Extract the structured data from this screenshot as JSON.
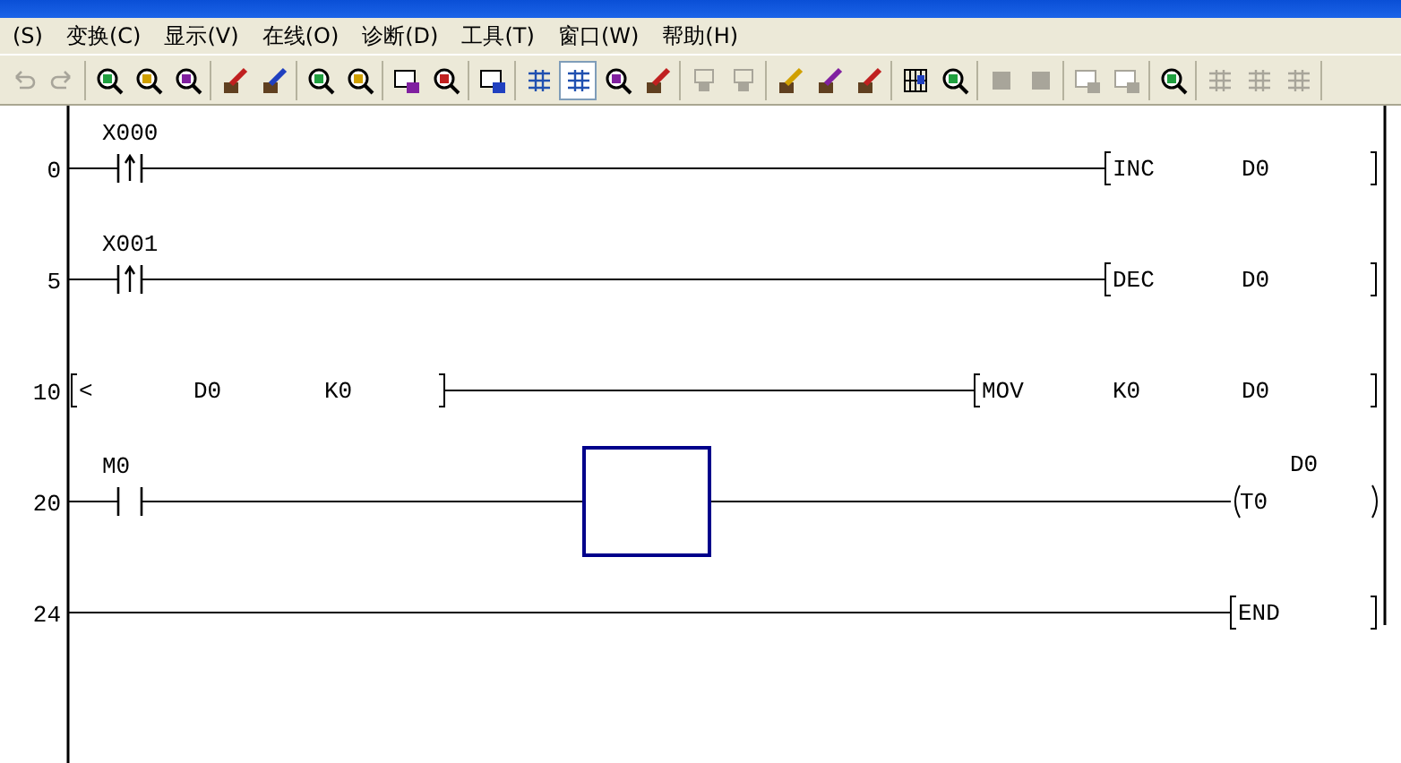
{
  "menu": [
    {
      "label": "(S)"
    },
    {
      "label": "变换(C)"
    },
    {
      "label": "显示(V)"
    },
    {
      "label": "在线(O)"
    },
    {
      "label": "诊断(D)"
    },
    {
      "label": "工具(T)"
    },
    {
      "label": "窗口(W)"
    },
    {
      "label": "帮助(H)"
    }
  ],
  "toolbar": [
    [
      {
        "disabled": true,
        "selected": false
      },
      {
        "disabled": true,
        "selected": false
      }
    ],
    [
      {
        "disabled": false,
        "selected": false
      },
      {
        "disabled": false,
        "selected": false
      },
      {
        "disabled": false,
        "selected": false
      }
    ],
    [
      {
        "disabled": false,
        "selected": false
      },
      {
        "disabled": false,
        "selected": false
      }
    ],
    [
      {
        "disabled": false,
        "selected": false
      },
      {
        "disabled": false,
        "selected": false
      }
    ],
    [
      {
        "disabled": false,
        "selected": false
      },
      {
        "disabled": false,
        "selected": false
      }
    ],
    [
      {
        "disabled": false,
        "selected": false
      }
    ],
    [
      {
        "disabled": false,
        "selected": false
      },
      {
        "disabled": false,
        "selected": true
      },
      {
        "disabled": false,
        "selected": false
      },
      {
        "disabled": false,
        "selected": false
      }
    ],
    [
      {
        "disabled": true,
        "selected": false
      },
      {
        "disabled": true,
        "selected": false
      }
    ],
    [
      {
        "disabled": false,
        "selected": false
      },
      {
        "disabled": false,
        "selected": false
      },
      {
        "disabled": false,
        "selected": false
      }
    ],
    [
      {
        "disabled": false,
        "selected": false
      },
      {
        "disabled": false,
        "selected": false
      }
    ],
    [
      {
        "disabled": true,
        "selected": false
      },
      {
        "disabled": true,
        "selected": false
      }
    ],
    [
      {
        "disabled": true,
        "selected": false
      },
      {
        "disabled": true,
        "selected": false
      }
    ],
    [
      {
        "disabled": false,
        "selected": false
      }
    ],
    [
      {
        "disabled": true,
        "selected": false
      },
      {
        "disabled": true,
        "selected": false
      },
      {
        "disabled": true,
        "selected": false
      }
    ]
  ],
  "ladder": {
    "rungs": [
      {
        "step": "0",
        "cursor": false,
        "condition": {
          "kind": "rising_contact",
          "label": "X000"
        },
        "output": {
          "kind": "instruction",
          "parts": [
            "INC",
            "D0"
          ]
        }
      },
      {
        "step": "5",
        "cursor": false,
        "condition": {
          "kind": "rising_contact",
          "label": "X001"
        },
        "output": {
          "kind": "instruction",
          "parts": [
            "DEC",
            "D0"
          ]
        }
      },
      {
        "step": "10",
        "cursor": false,
        "condition": {
          "kind": "compare",
          "parts": [
            "<",
            "D0",
            "K0"
          ]
        },
        "output": {
          "kind": "instruction",
          "parts": [
            "MOV",
            "K0",
            "D0"
          ]
        }
      },
      {
        "step": "20",
        "cursor": true,
        "condition": {
          "kind": "contact",
          "label": "M0"
        },
        "output": {
          "kind": "coil",
          "parts": [
            "T0"
          ],
          "setting": "D0"
        }
      },
      {
        "step": "24",
        "cursor": false,
        "output": {
          "kind": "instruction",
          "parts": [
            "END"
          ]
        }
      }
    ]
  }
}
